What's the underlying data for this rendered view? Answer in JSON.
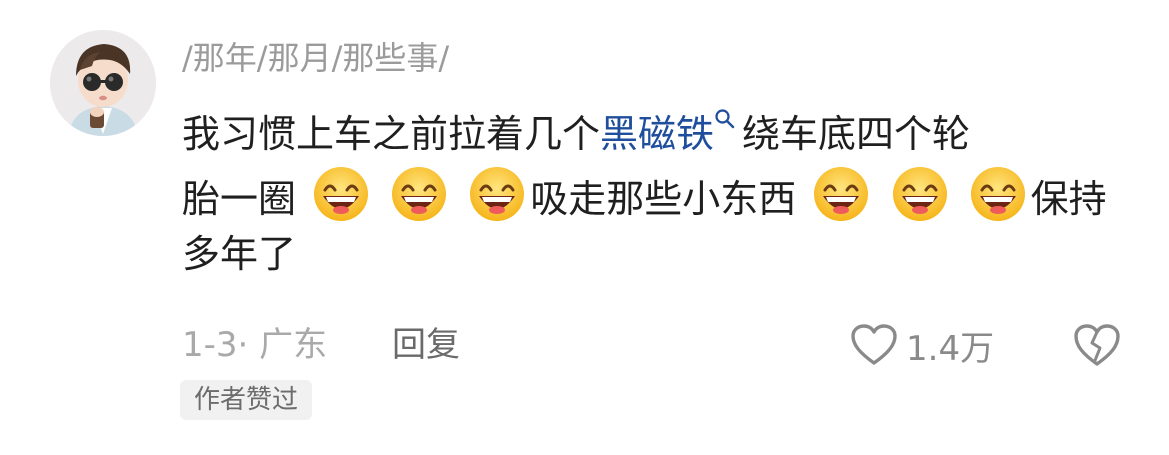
{
  "comment": {
    "username": "/那年/那月/那些事/",
    "text_before": "我习惯上车之前拉着几个",
    "keyword": "黑磁铁",
    "keyword_icon": "search-icon",
    "text_after_keyword": "绕车底四个轮",
    "line2_text_a": "胎一圈",
    "line2_text_b": "吸走那些小东西",
    "line2_text_c": "保持",
    "line3_text": "多年了",
    "emoji": "grinning-face-emoji",
    "keyword_color": "#1f4e9c",
    "date_location": "1-3· 广东",
    "reply_label": "回复",
    "like_count": "1.4万",
    "dislike_icon": "broken-heart-icon",
    "author_badge": "作者赞过"
  }
}
